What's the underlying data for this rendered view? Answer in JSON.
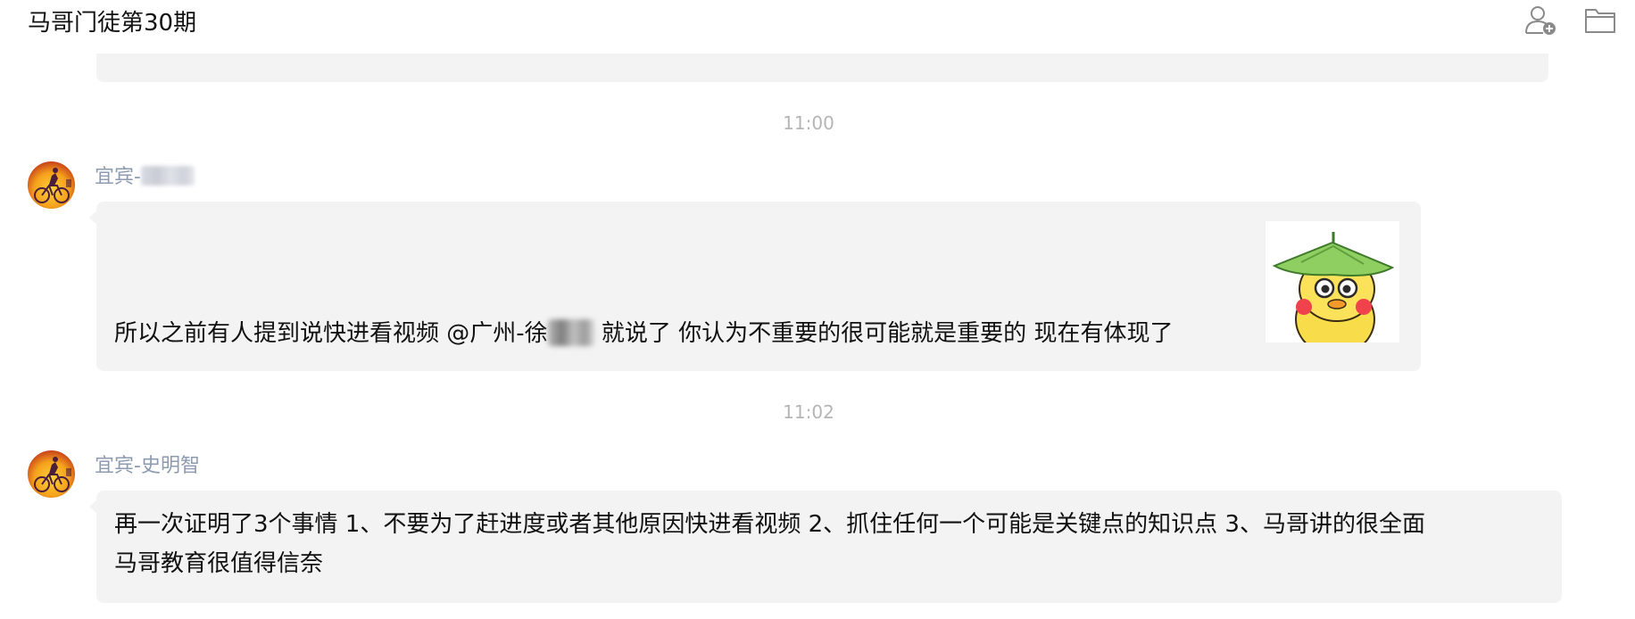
{
  "window": {
    "title": "马哥门徒第30期"
  },
  "toolbar": {
    "add_member_icon": "add-member-icon",
    "folder_icon": "folder-icon"
  },
  "messages": [
    {
      "timestamp": "11:00",
      "sender_prefix": "宜宾-",
      "sender_name_blurred": true,
      "text_parts": [
        "所以之前有人提到说快进看视频  @广州-徐",
        " 就说了 你认为不重要的很可能就是重要的  现在有体现了"
      ],
      "sticker": "duck-with-leaf-hat-sticker"
    },
    {
      "timestamp": "11:02",
      "sender": "宜宾-史明智",
      "text_line1": "再一次证明了3个事情 1、不要为了赶进度或者其他原因快进看视频  2、抓住任何一个可能是关键点的知识点  3、马哥讲的很全面",
      "text_line2": "马哥教育很值得信奈"
    }
  ],
  "colors": {
    "bubble_bg": "#f3f3f3",
    "sender_name": "#8d9bb0",
    "timestamp": "#b5b5b5",
    "text": "#111111"
  }
}
